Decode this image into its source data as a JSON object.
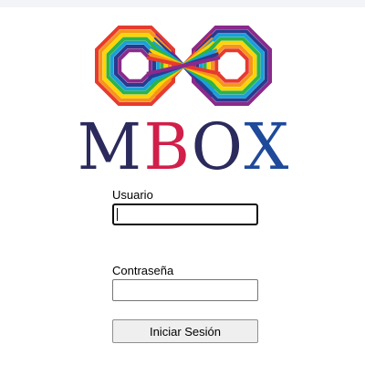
{
  "brand": {
    "logo_letters": [
      {
        "char": "M",
        "color": "#2b2a5c"
      },
      {
        "char": "B",
        "color": "#d11f4a"
      },
      {
        "char": "O",
        "color": "#2b2a5c"
      },
      {
        "char": "X",
        "color": "#1f4a9a"
      }
    ],
    "mark_colors": [
      "#e63b2e",
      "#f7941d",
      "#ffd400",
      "#2db34a",
      "#1aa0d8",
      "#2b3a8f",
      "#8a2a8c"
    ]
  },
  "login": {
    "username_label": "Usuario",
    "username_value": "",
    "password_label": "Contraseña",
    "password_value": "",
    "submit_label": "Iniciar Sesión"
  }
}
